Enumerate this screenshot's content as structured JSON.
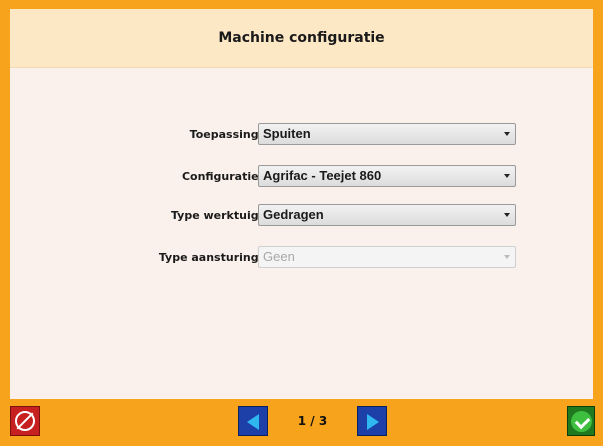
{
  "header": {
    "title": "Machine configuratie"
  },
  "form": {
    "fields": [
      {
        "label": "Toepassing:",
        "value": "Spuiten",
        "enabled": true
      },
      {
        "label": "Configuratie:",
        "value": "Agrifac - Teejet 860",
        "enabled": true
      },
      {
        "label": "Type werktuig:",
        "value": "Gedragen",
        "enabled": true
      },
      {
        "label": "Type aansturing:",
        "value": "Geen",
        "enabled": false
      }
    ]
  },
  "footer": {
    "page_indicator": "1 / 3",
    "cancel_icon": "prohibited-icon",
    "prev_icon": "arrow-left-icon",
    "next_icon": "arrow-right-icon",
    "ok_icon": "checkmark-icon"
  },
  "colors": {
    "frame": "#f7a31c",
    "header_bg": "#fde8c6",
    "panel_bg": "#fbf1ec",
    "cancel": "#c62020",
    "nav": "#1d3fa8",
    "nav_arrow": "#2fb8f0",
    "ok": "#1f7a1f"
  }
}
